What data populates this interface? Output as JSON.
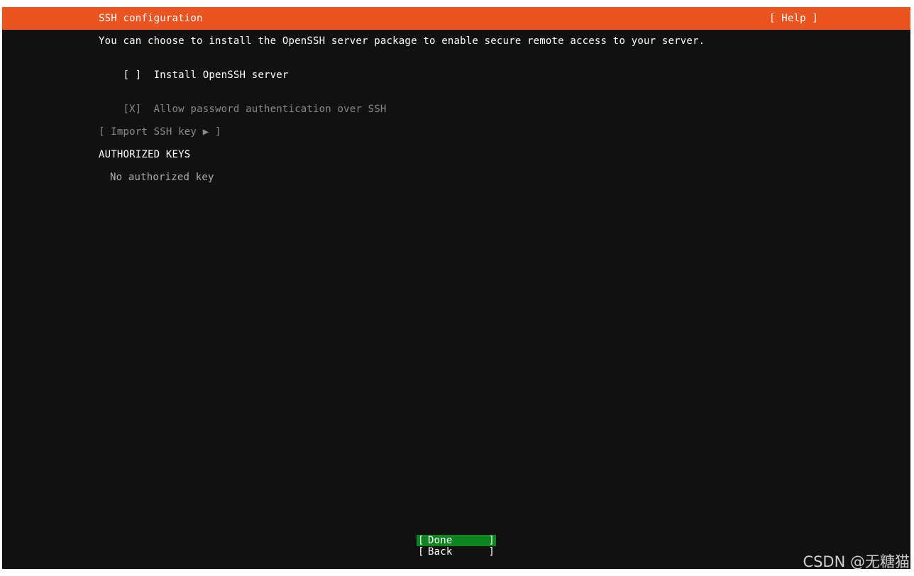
{
  "header": {
    "title": "SSH configuration",
    "help_label": "[ Help ]"
  },
  "content": {
    "description": "You can choose to install the OpenSSH server package to enable secure remote access to your server.",
    "install_openssh": {
      "checkbox": "[ ]",
      "label": "Install OpenSSH server"
    },
    "allow_password": {
      "checkbox": "[X]",
      "label": "Allow password authentication over SSH"
    },
    "import_ssh_key_label": "[ Import SSH key ▶ ]",
    "authorized_keys_heading": "AUTHORIZED KEYS",
    "no_authorized_key": "No authorized key"
  },
  "buttons": {
    "open_bracket": "[",
    "close_bracket": "]",
    "done_label": "Done",
    "back_label": "Back"
  },
  "watermark": "CSDN @无糖猫",
  "colors": {
    "header_bg": "#e95420",
    "done_bg": "#0e8420",
    "screen_bg": "#111111"
  }
}
